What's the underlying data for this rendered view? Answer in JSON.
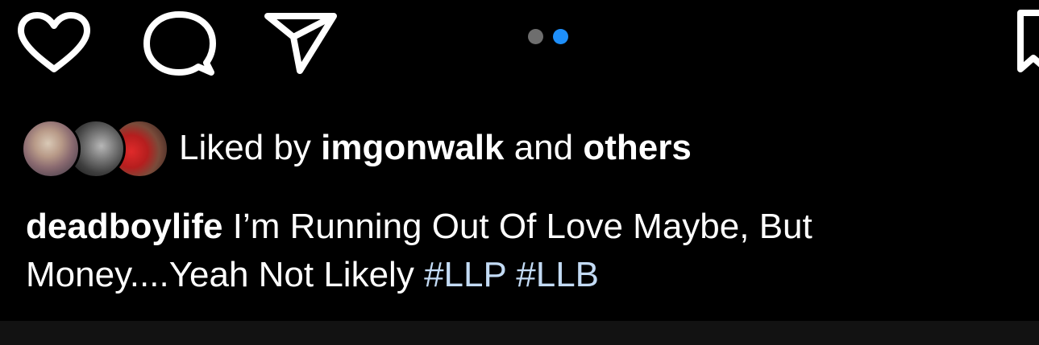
{
  "actions": {
    "like_icon": "heart-outline-icon",
    "comment_icon": "comment-bubble-icon",
    "share_icon": "paper-plane-icon",
    "save_icon": "bookmark-icon"
  },
  "carousel": {
    "total": 2,
    "active_index": 1,
    "inactive_color": "#6e6e6e",
    "active_color": "#1e8ffa"
  },
  "likes": {
    "prefix": "Liked by ",
    "user": "imgonwalk",
    "connector": " and ",
    "others": "others"
  },
  "caption": {
    "username": "deadboylife",
    "text": " I’m Running Out Of Love Maybe, But Money....Yeah Not Likely ",
    "hashtag_1": "#LLP",
    "hashtag_2": "#LLB",
    "hashtag_color": "#c3dbf5"
  },
  "colors": {
    "background": "#000000",
    "text": "#ffffff",
    "bottom_bar": "#121212"
  }
}
